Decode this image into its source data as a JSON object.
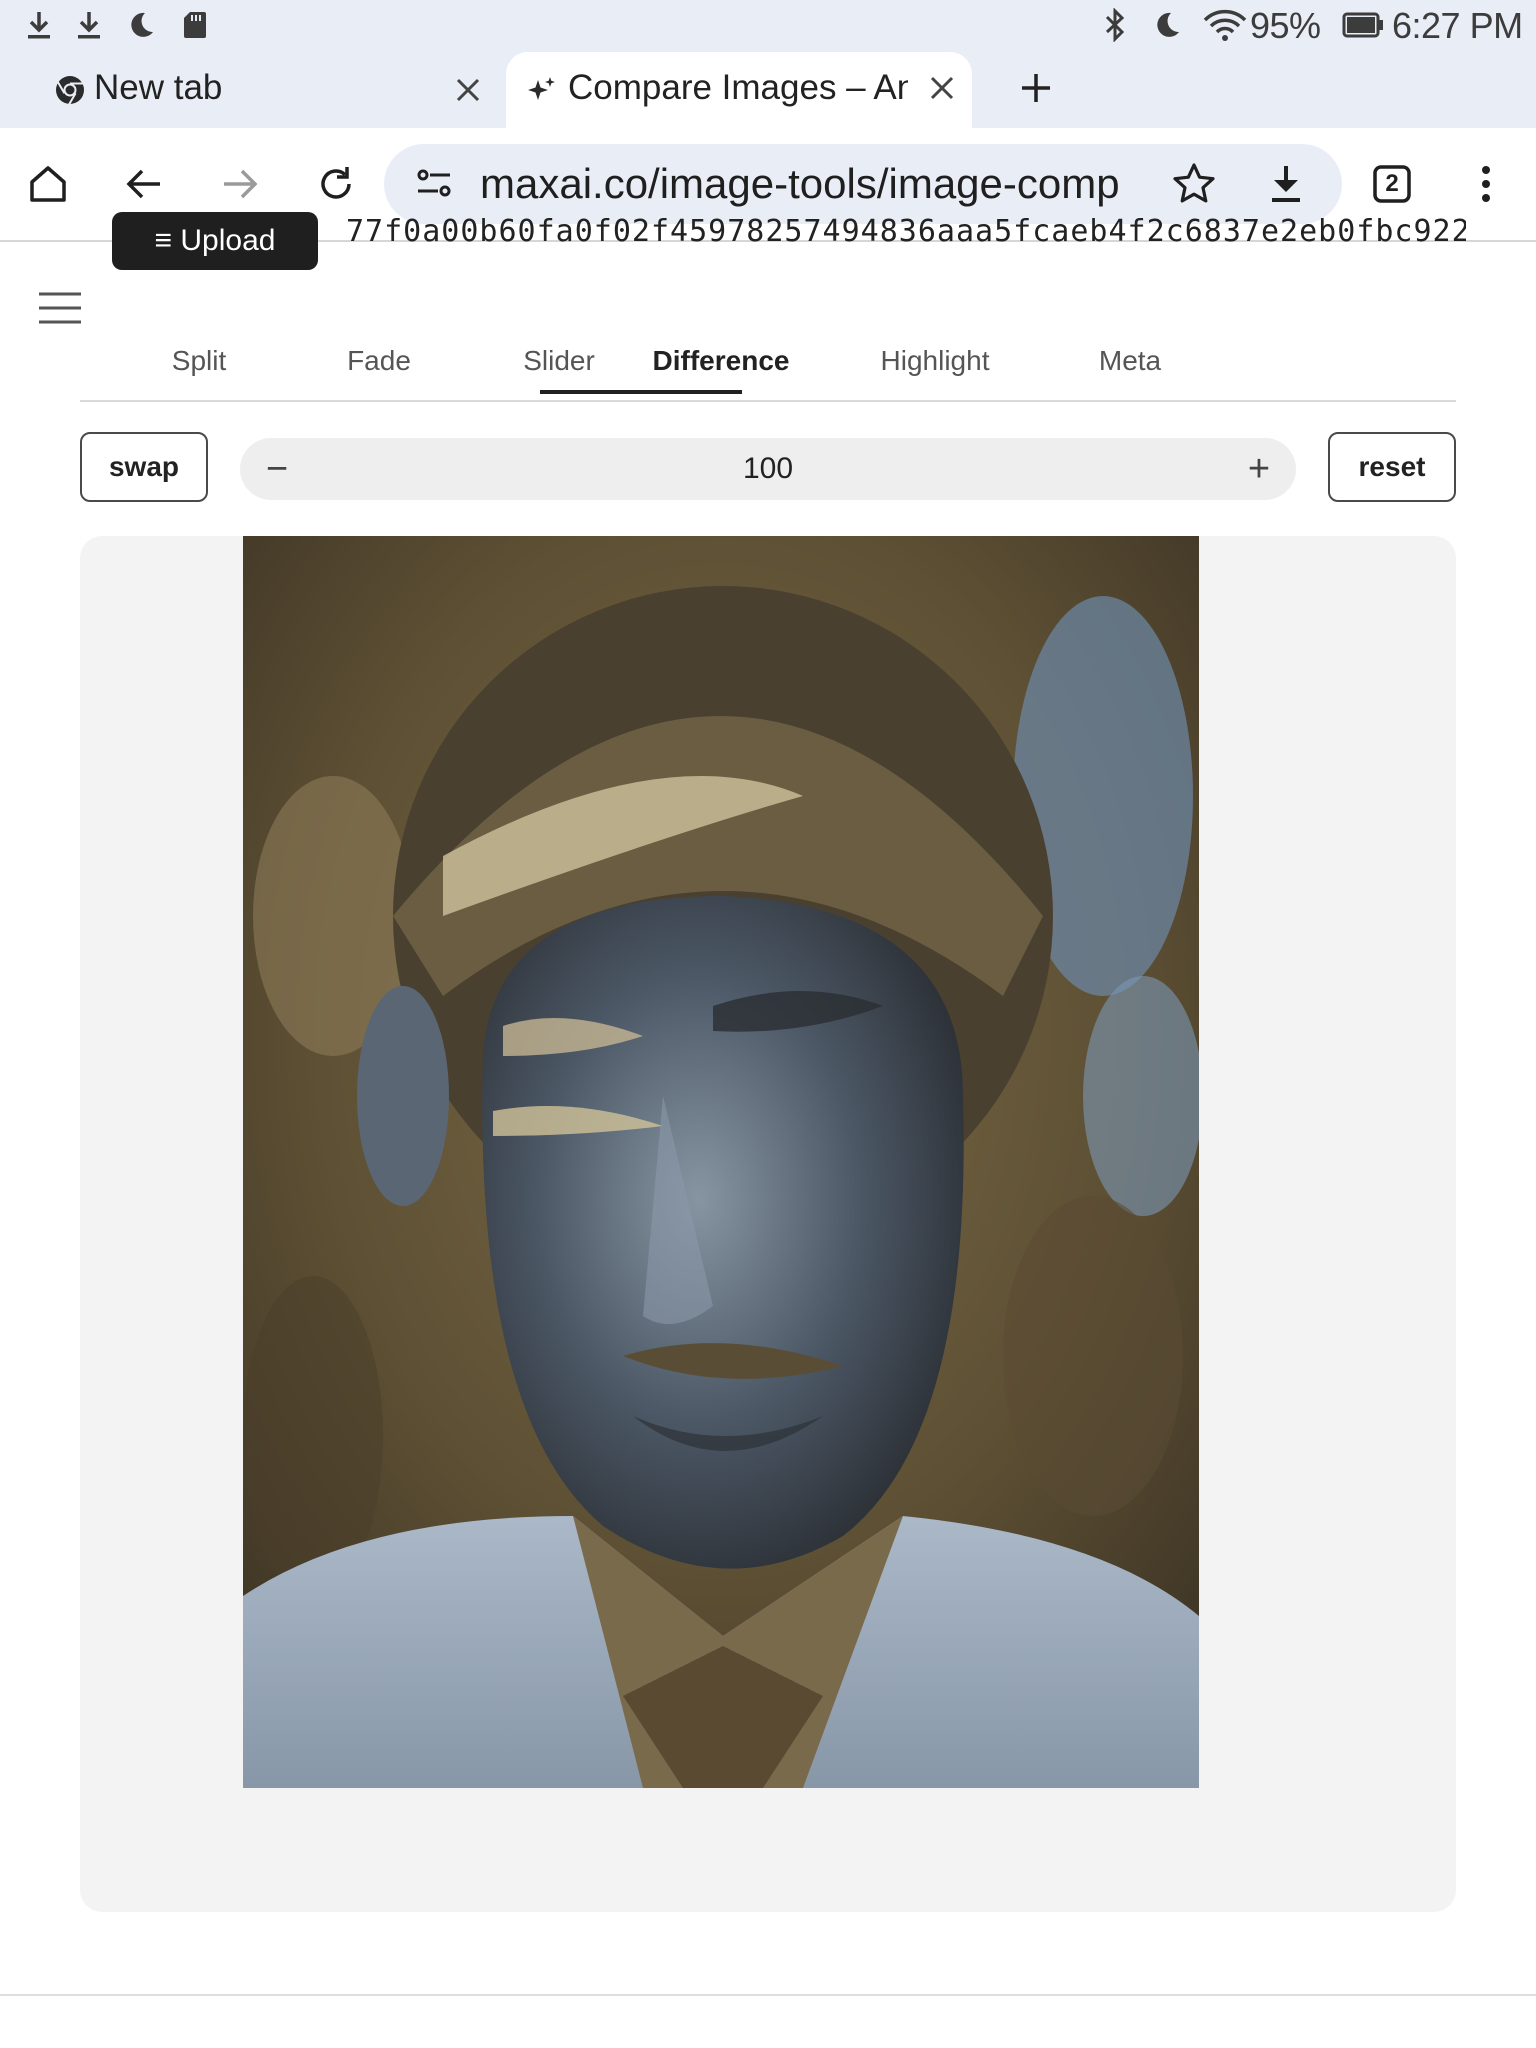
{
  "status_bar": {
    "left_icons": [
      "download-icon",
      "download-icon",
      "moon-icon",
      "sd-card-icon"
    ],
    "right_icons": [
      "bluetooth-icon",
      "moon-icon",
      "wifi-icon",
      "battery-icon"
    ],
    "battery_percent": "95%",
    "time": "6:27 PM"
  },
  "tabs": [
    {
      "title": "New tab",
      "icon": "chrome-icon",
      "active": false
    },
    {
      "title": "Compare Images – An",
      "icon": "sparkle-icon",
      "active": true
    }
  ],
  "toolbar": {
    "url": "maxai.co/image-tools/image-comp",
    "tab_count": "2"
  },
  "page": {
    "upload_label": "≡ Upload",
    "hash_text": "77f0a00b60fa0f02f45978257494836aaa5fcaeb4f2c6837e2eb0fbc922…",
    "mode_tabs": [
      "Split",
      "Fade",
      "Slider",
      "Difference",
      "Highlight",
      "Meta"
    ],
    "active_mode": "Difference",
    "swap_label": "swap",
    "reset_label": "reset",
    "stepper_value": "100",
    "minus_symbol": "−",
    "plus_symbol": "+"
  }
}
